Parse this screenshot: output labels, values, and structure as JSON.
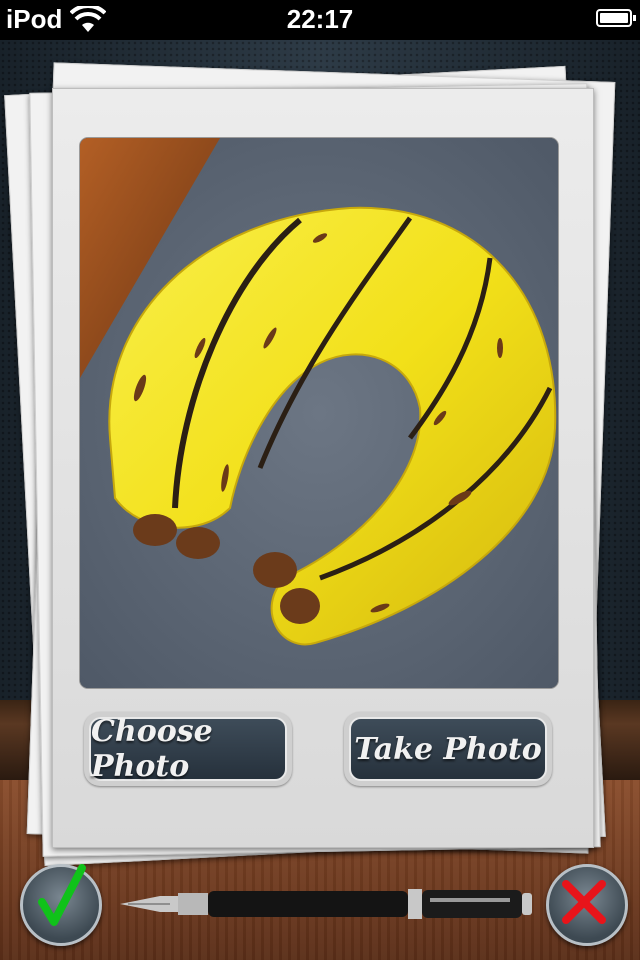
{
  "status_bar": {
    "carrier": "iPod",
    "time": "22:17",
    "wifi_icon": "wifi-icon",
    "battery_icon": "battery-icon"
  },
  "photo": {
    "image": "banana-neck-pillow-photo"
  },
  "buttons": {
    "choose_photo": "Choose Photo",
    "take_photo": "Take Photo"
  },
  "bottom_bar": {
    "confirm_icon": "checkmark-icon",
    "cancel_icon": "close-icon",
    "pen_icon": "fountain-pen-icon"
  },
  "colors": {
    "confirm": "#10c21a",
    "cancel": "#e8141a",
    "button_bg": "#2e3a46"
  }
}
